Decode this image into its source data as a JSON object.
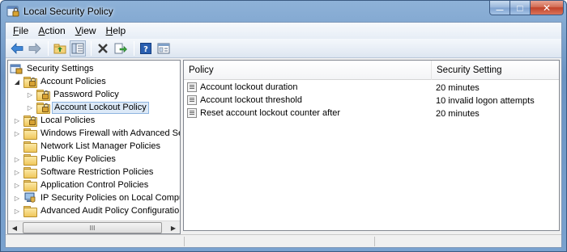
{
  "window": {
    "title": "Local Security Policy",
    "app_icon": "security-policy-icon"
  },
  "caption_buttons": {
    "minimize": "—",
    "maximize": "□",
    "close": "✕"
  },
  "menu": [
    {
      "label": "File",
      "accel": "F"
    },
    {
      "label": "Action",
      "accel": "A"
    },
    {
      "label": "View",
      "accel": "V"
    },
    {
      "label": "Help",
      "accel": "H"
    }
  ],
  "toolbar": {
    "icons": [
      "back-arrow-icon",
      "forward-arrow-icon",
      "up-folder-icon",
      "show-hide-tree-icon",
      "delete-icon",
      "export-list-icon",
      "help-icon",
      "properties-icon"
    ]
  },
  "tree": {
    "items": [
      {
        "label": "Security Settings",
        "expander": "",
        "icon": "security-settings-icon"
      },
      {
        "label": "Account Policies",
        "expander": "◢",
        "icon": "folder-lock-icon"
      },
      {
        "label": "Password Policy",
        "expander": "▷",
        "icon": "folder-lock-icon"
      },
      {
        "label": "Account Lockout Policy",
        "expander": "▷",
        "icon": "folder-lock-icon"
      },
      {
        "label": "Local Policies",
        "expander": "▷",
        "icon": "folder-lock-icon"
      },
      {
        "label": "Windows Firewall with Advanced Secu",
        "expander": "▷",
        "icon": "folder-icon"
      },
      {
        "label": "Network List Manager Policies",
        "expander": "",
        "icon": "folder-icon"
      },
      {
        "label": "Public Key Policies",
        "expander": "▷",
        "icon": "folder-icon"
      },
      {
        "label": "Software Restriction Policies",
        "expander": "▷",
        "icon": "folder-icon"
      },
      {
        "label": "Application Control Policies",
        "expander": "▷",
        "icon": "folder-icon"
      },
      {
        "label": "IP Security Policies on Local Compute",
        "expander": "▷",
        "icon": "ip-security-icon"
      },
      {
        "label": "Advanced Audit Policy Configuration",
        "expander": "▷",
        "icon": "folder-icon"
      }
    ],
    "selected_index": 3,
    "hscroll": {
      "left": "◀",
      "right": "▶",
      "grip": "III"
    }
  },
  "list": {
    "columns": {
      "policy": "Policy",
      "setting": "Security Setting"
    },
    "sort_indicator": "▲",
    "rows": [
      {
        "policy": "Account lockout duration",
        "setting": "20 minutes"
      },
      {
        "policy": "Account lockout threshold",
        "setting": "10 invalid logon attempts"
      },
      {
        "policy": "Reset account lockout counter after",
        "setting": "20 minutes"
      }
    ]
  }
}
